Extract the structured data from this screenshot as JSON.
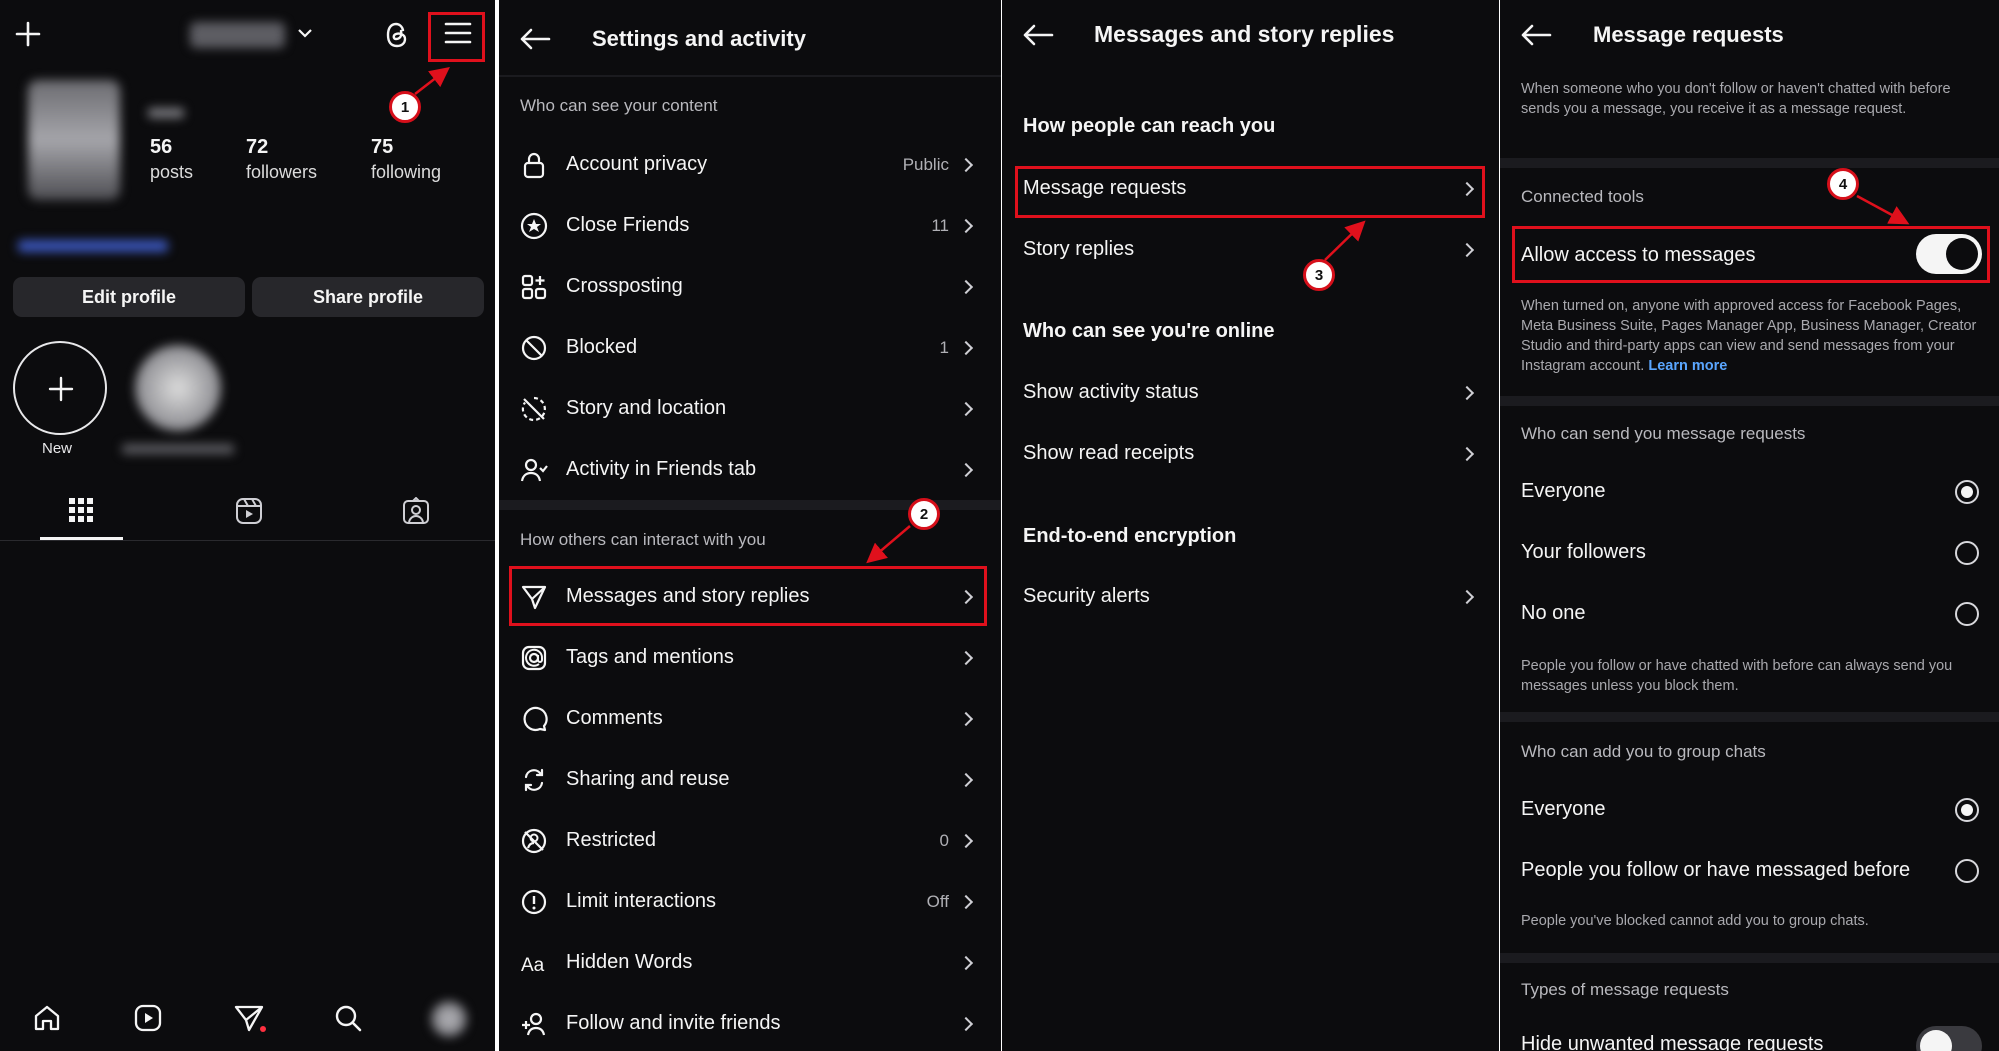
{
  "panel_profile": {
    "stats": [
      {
        "value": "56",
        "label": "posts"
      },
      {
        "value": "72",
        "label": "followers"
      },
      {
        "value": "75",
        "label": "following"
      }
    ],
    "edit_profile": "Edit profile",
    "share_profile": "Share profile",
    "new_highlight": "New",
    "icons": [
      "plus-icon",
      "chevron-down-icon",
      "threads-icon",
      "menu-icon",
      "grid-icon",
      "reels-icon",
      "tagged-icon",
      "home-icon",
      "reels-nav-icon",
      "messages-icon",
      "search-icon",
      "avatar"
    ]
  },
  "panel_settings": {
    "title": "Settings and activity",
    "section1": "Who can see your content",
    "rows1": [
      {
        "label": "Account privacy",
        "value": "Public",
        "icon": "lock-icon"
      },
      {
        "label": "Close Friends",
        "value": "11",
        "icon": "star-icon"
      },
      {
        "label": "Crossposting",
        "value": "",
        "icon": "crosspost-icon"
      },
      {
        "label": "Blocked",
        "value": "1",
        "icon": "blocked-icon"
      },
      {
        "label": "Story and location",
        "value": "",
        "icon": "story-location-icon"
      },
      {
        "label": "Activity in Friends tab",
        "value": "",
        "icon": "friends-icon"
      }
    ],
    "section2": "How others can interact with you",
    "rows2": [
      {
        "label": "Messages and story replies",
        "value": "",
        "icon": "send-icon"
      },
      {
        "label": "Tags and mentions",
        "value": "",
        "icon": "at-icon"
      },
      {
        "label": "Comments",
        "value": "",
        "icon": "comment-icon"
      },
      {
        "label": "Sharing and reuse",
        "value": "",
        "icon": "share-icon"
      },
      {
        "label": "Restricted",
        "value": "0",
        "icon": "restricted-icon"
      },
      {
        "label": "Limit interactions",
        "value": "Off",
        "icon": "limit-icon"
      },
      {
        "label": "Hidden Words",
        "value": "",
        "icon": "hidden-words-icon"
      },
      {
        "label": "Follow and invite friends",
        "value": "",
        "icon": "invite-icon"
      }
    ]
  },
  "panel_messages": {
    "title": "Messages and story replies",
    "section1": "How people can reach you",
    "rows1": [
      "Message requests",
      "Story replies"
    ],
    "section2": "Who can see you're online",
    "rows2": [
      "Show activity status",
      "Show read receipts"
    ],
    "section3": "End-to-end encryption",
    "rows3": [
      "Security alerts"
    ]
  },
  "panel_requests": {
    "title": "Message requests",
    "intro": "When someone who you don't follow or haven't chatted with before sends you a message, you receive it as a message request.",
    "connected_tools": "Connected tools",
    "allow_access": "Allow access to messages",
    "allow_access_on": true,
    "allow_desc": "When turned on, anyone with approved access for Facebook Pages, Meta Business Suite, Pages Manager App, Business Manager, Creator Studio and third-party apps can view and send messages from your Instagram account.",
    "learn_more": "Learn more",
    "who_send": "Who can send you message requests",
    "send_options": [
      {
        "label": "Everyone",
        "selected": true
      },
      {
        "label": "Your followers",
        "selected": false
      },
      {
        "label": "No one",
        "selected": false
      }
    ],
    "send_note": "People you follow or have chatted with before can always send you messages unless you block them.",
    "who_group": "Who can add you to group chats",
    "group_options": [
      {
        "label": "Everyone",
        "selected": true
      },
      {
        "label": "People you follow or have messaged before",
        "selected": false
      }
    ],
    "group_note": "People you've blocked cannot add you to group chats.",
    "types": "Types of message requests",
    "hide_unwanted": "Hide unwanted message requests"
  },
  "annotations": [
    "1",
    "2",
    "3",
    "4"
  ],
  "colors": {
    "background": "#0c0c0e",
    "highlight": "#e0101c",
    "link": "#5aa6ff"
  }
}
